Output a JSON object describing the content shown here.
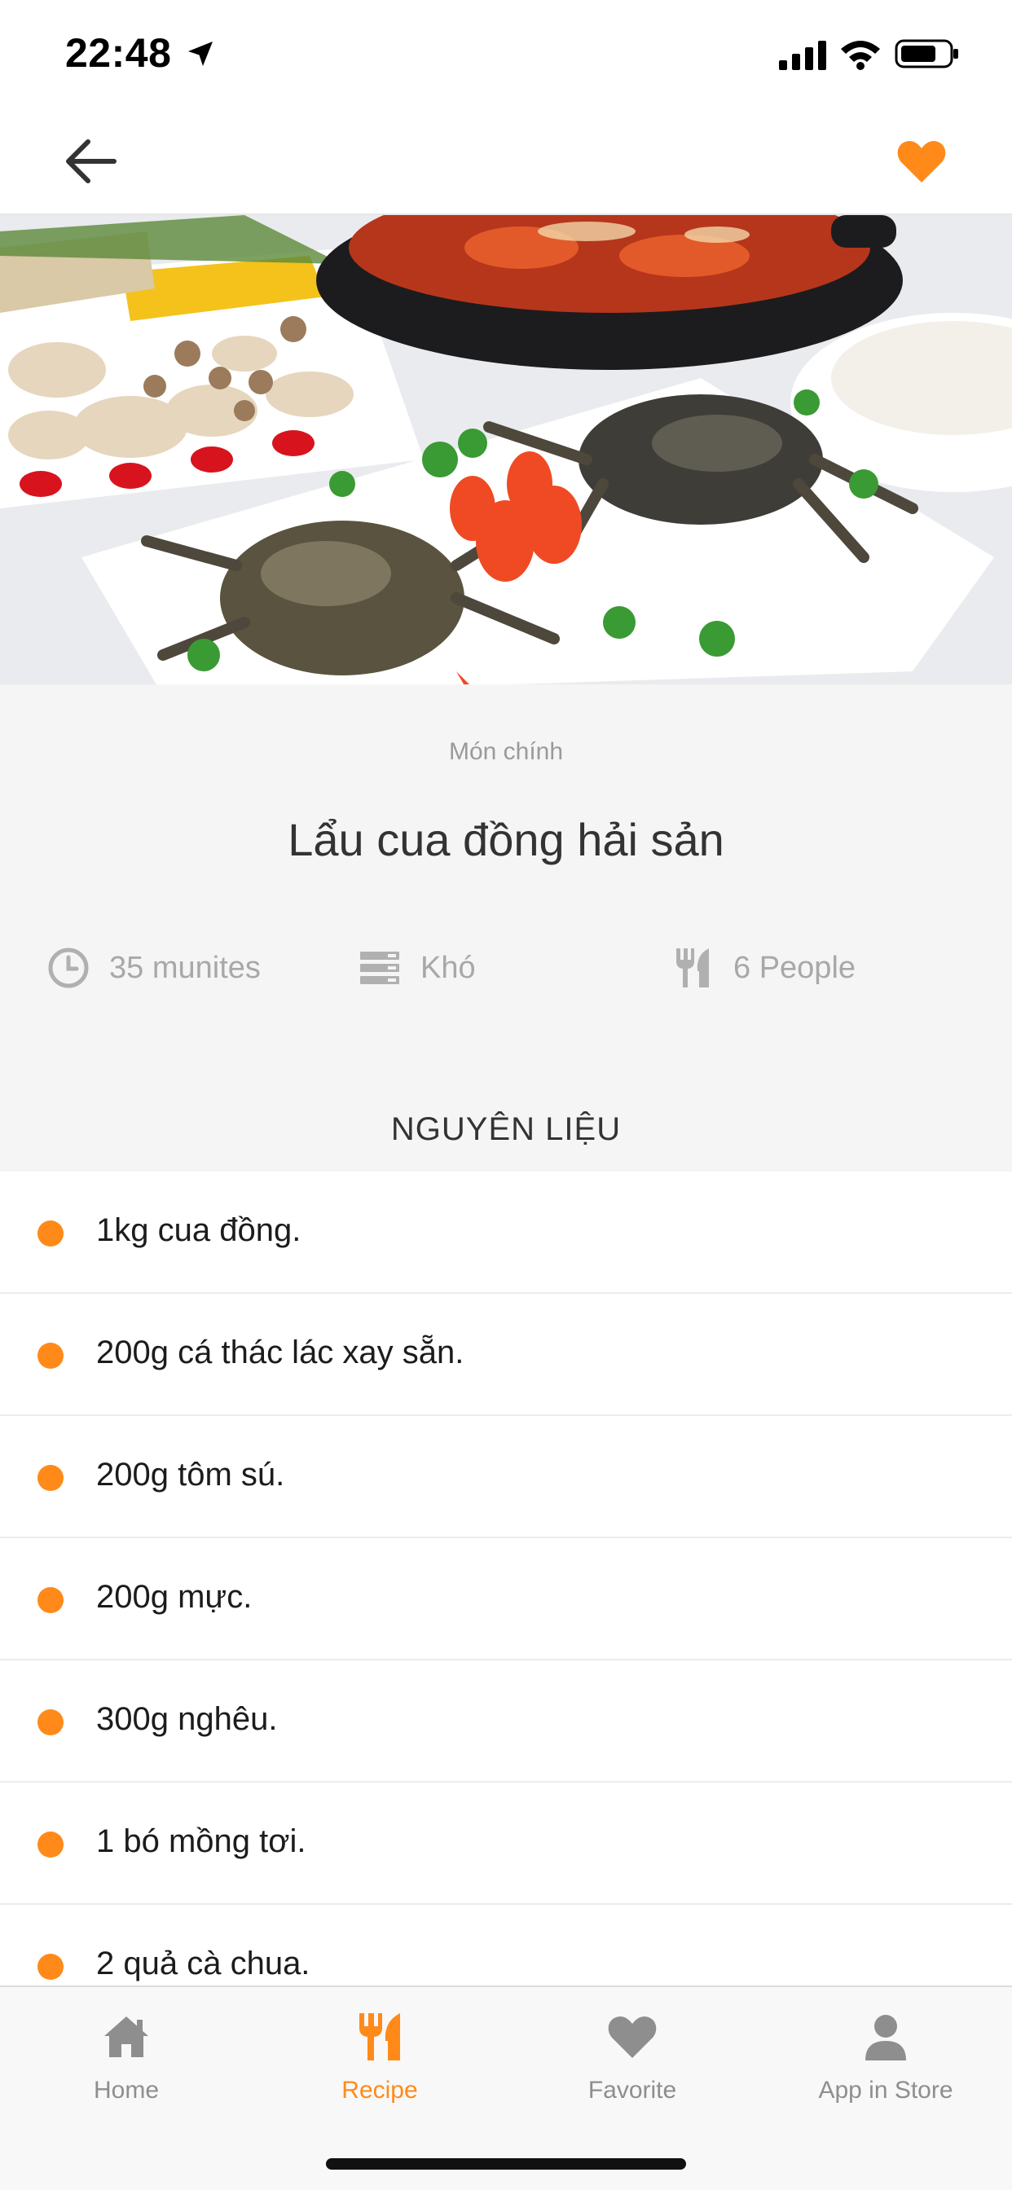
{
  "status_bar": {
    "time": "22:48"
  },
  "recipe": {
    "category": "Món chính",
    "title": "Lẩu cua đồng hải sản",
    "meta": {
      "time": "35 munites",
      "level": "Khó",
      "servings": "6 People"
    },
    "section_title": "NGUYÊN LIỆU",
    "ingredients": [
      "1kg cua đồng.",
      "200g cá thác lác xay sẵn.",
      "200g tôm sú.",
      "200g mực.",
      "300g nghêu.",
      "1 bó mồng tơi.",
      "2 quả cà chua."
    ]
  },
  "tabs": [
    {
      "label": "Home",
      "icon": "home-icon"
    },
    {
      "label": "Recipe",
      "icon": "fork-knife-icon",
      "active": true
    },
    {
      "label": "Favorite",
      "icon": "heart-icon"
    },
    {
      "label": "App in Store",
      "icon": "person-icon"
    }
  ],
  "colors": {
    "accent": "#ff8a1a",
    "muted": "#a8a8a8",
    "panel": "#f5f5f5"
  }
}
